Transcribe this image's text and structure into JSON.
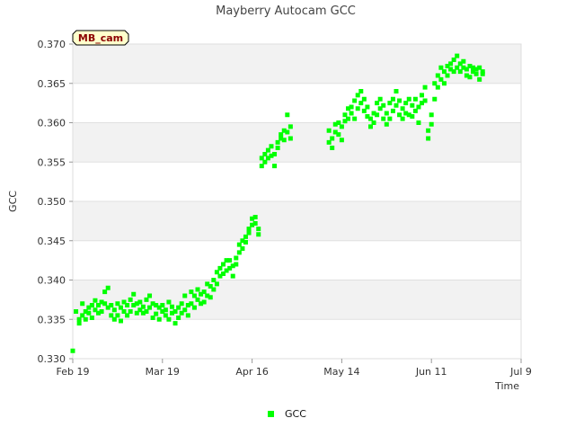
{
  "chart_data": {
    "type": "scatter",
    "title": "Mayberry Autocam GCC",
    "badge": "MB_cam",
    "xlabel": "Time",
    "ylabel": "GCC",
    "x_start": "Feb 19",
    "ylim": [
      0.33,
      0.37
    ],
    "yticks": [
      "0.330",
      "0.335",
      "0.340",
      "0.345",
      "0.350",
      "0.355",
      "0.360",
      "0.365",
      "0.370"
    ],
    "xlim_days": [
      0,
      140
    ],
    "xticks": [
      {
        "label": "Feb 19",
        "day": 0
      },
      {
        "label": "Mar 19",
        "day": 28
      },
      {
        "label": "Apr 16",
        "day": 56
      },
      {
        "label": "May 14",
        "day": 84
      },
      {
        "label": "Jun 11",
        "day": 112
      },
      {
        "label": "Jul 9",
        "day": 140
      }
    ],
    "grid": true,
    "legend_position": "bottom",
    "series": [
      {
        "name": "GCC",
        "color": "#00ff00",
        "day": [
          0,
          1,
          2,
          2,
          3,
          3,
          4,
          4,
          5,
          5,
          6,
          6,
          7,
          7,
          8,
          8,
          9,
          9,
          10,
          10,
          11,
          11,
          12,
          12,
          13,
          13,
          14,
          14,
          15,
          15,
          16,
          16,
          17,
          17,
          18,
          18,
          19,
          19,
          20,
          20,
          21,
          21,
          22,
          22,
          23,
          23,
          24,
          24,
          25,
          25,
          26,
          26,
          27,
          27,
          28,
          28,
          29,
          29,
          30,
          30,
          31,
          31,
          32,
          32,
          33,
          33,
          34,
          34,
          35,
          35,
          36,
          36,
          37,
          37,
          38,
          38,
          39,
          39,
          40,
          40,
          41,
          41,
          42,
          42,
          43,
          43,
          44,
          44,
          45,
          45,
          46,
          46,
          47,
          47,
          48,
          48,
          49,
          49,
          50,
          50,
          51,
          51,
          52,
          52,
          53,
          53,
          54,
          54,
          55,
          55,
          56,
          56,
          57,
          57,
          58,
          58,
          59,
          59,
          60,
          60,
          61,
          61,
          62,
          62,
          63,
          63,
          64,
          64,
          65,
          65,
          66,
          66,
          67,
          67,
          68,
          68,
          80,
          80,
          81,
          81,
          82,
          82,
          83,
          83,
          84,
          84,
          85,
          85,
          86,
          86,
          87,
          87,
          88,
          88,
          89,
          89,
          90,
          90,
          91,
          91,
          92,
          92,
          93,
          93,
          94,
          94,
          95,
          95,
          96,
          96,
          97,
          97,
          98,
          98,
          99,
          99,
          100,
          100,
          101,
          101,
          102,
          102,
          103,
          103,
          104,
          104,
          105,
          105,
          106,
          106,
          107,
          107,
          108,
          108,
          109,
          109,
          110,
          110,
          111,
          111,
          112,
          112,
          113,
          113,
          114,
          114,
          115,
          115,
          116,
          116,
          117,
          117,
          118,
          118,
          119,
          119,
          120,
          120,
          121,
          121,
          122,
          122,
          123,
          123,
          124,
          124,
          125,
          125,
          126,
          126,
          127,
          127,
          128,
          128,
          129,
          129,
          130,
          130,
          131,
          131,
          132,
          132,
          133,
          133,
          134,
          134,
          135,
          135,
          136,
          136,
          137,
          137,
          138,
          138,
          139,
          139
        ],
        "gcc": [
          0.331,
          0.336,
          0.335,
          0.3345,
          0.337,
          0.3355,
          0.335,
          0.336,
          0.3365,
          0.3358,
          0.3368,
          0.3352,
          0.3362,
          0.3374,
          0.3358,
          0.3368,
          0.3372,
          0.336,
          0.3385,
          0.337,
          0.339,
          0.3365,
          0.3355,
          0.3368,
          0.335,
          0.3362,
          0.337,
          0.3355,
          0.3365,
          0.3348,
          0.336,
          0.3372,
          0.3355,
          0.3368,
          0.3375,
          0.336,
          0.3382,
          0.3368,
          0.337,
          0.3358,
          0.3362,
          0.3372,
          0.3358,
          0.3366,
          0.3375,
          0.336,
          0.338,
          0.3365,
          0.337,
          0.3352,
          0.3368,
          0.3357,
          0.3365,
          0.335,
          0.336,
          0.3368,
          0.3355,
          0.3362,
          0.3372,
          0.335,
          0.3358,
          0.3366,
          0.3345,
          0.336,
          0.3365,
          0.3352,
          0.337,
          0.3358,
          0.3362,
          0.338,
          0.3355,
          0.3368,
          0.3385,
          0.337,
          0.338,
          0.3365,
          0.3375,
          0.3388,
          0.337,
          0.3382,
          0.3385,
          0.3372,
          0.3395,
          0.338,
          0.3392,
          0.3378,
          0.34,
          0.3388,
          0.341,
          0.3395,
          0.3415,
          0.3405,
          0.342,
          0.3408,
          0.3425,
          0.3412,
          0.3415,
          0.3425,
          0.3405,
          0.3418,
          0.342,
          0.3428,
          0.3435,
          0.3445,
          0.344,
          0.345,
          0.3448,
          0.3455,
          0.346,
          0.3465,
          0.347,
          0.3478,
          0.3472,
          0.348,
          0.3465,
          0.3458,
          0.3555,
          0.3545,
          0.356,
          0.355,
          0.3565,
          0.3555,
          0.357,
          0.3558,
          0.3545,
          0.356,
          0.3575,
          0.3568,
          0.358,
          0.3585,
          0.359,
          0.3578,
          0.361,
          0.3588,
          0.3595,
          0.358,
          0.3575,
          0.359,
          0.3568,
          0.358,
          0.3588,
          0.3598,
          0.3585,
          0.36,
          0.3595,
          0.3578,
          0.361,
          0.3602,
          0.3618,
          0.3605,
          0.362,
          0.3612,
          0.3628,
          0.3605,
          0.3635,
          0.3618,
          0.364,
          0.3625,
          0.363,
          0.3615,
          0.3608,
          0.362,
          0.3595,
          0.3605,
          0.3612,
          0.36,
          0.3625,
          0.361,
          0.363,
          0.3618,
          0.3605,
          0.3622,
          0.3598,
          0.3612,
          0.3605,
          0.3625,
          0.3615,
          0.363,
          0.364,
          0.3622,
          0.361,
          0.3628,
          0.3618,
          0.3605,
          0.3625,
          0.3612,
          0.363,
          0.361,
          0.3622,
          0.3608,
          0.3615,
          0.363,
          0.362,
          0.36,
          0.3625,
          0.3635,
          0.3645,
          0.3628,
          0.359,
          0.358,
          0.361,
          0.3598,
          0.365,
          0.363,
          0.366,
          0.3645,
          0.367,
          0.3655,
          0.3665,
          0.365,
          0.3672,
          0.366,
          0.3668,
          0.3675,
          0.3665,
          0.368,
          0.367,
          0.3685,
          0.3675,
          0.3665,
          0.3678,
          0.367,
          0.366,
          0.3668,
          0.3672,
          0.3658,
          0.3665,
          0.367,
          0.3662,
          0.3668,
          0.3655,
          0.367,
          0.3662,
          0.3665
        ]
      }
    ]
  }
}
